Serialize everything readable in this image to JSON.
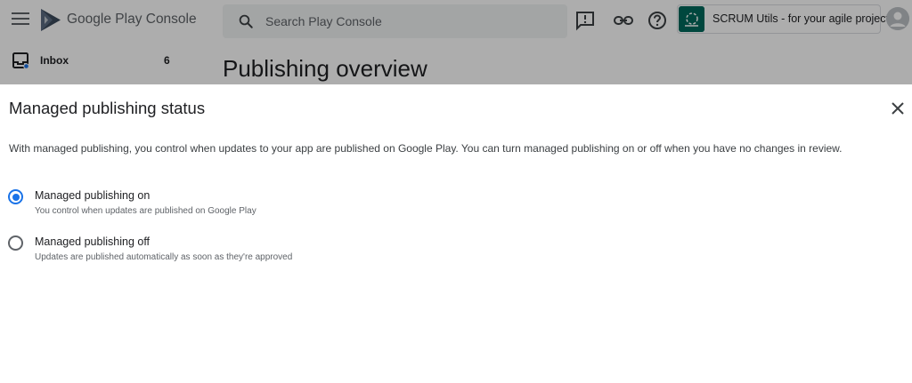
{
  "header": {
    "brand": "Google Play Console",
    "search_placeholder": "Search Play Console",
    "app_name": "SCRUM Utils - for your agile project"
  },
  "sidebar": {
    "items": [
      {
        "label": "Inbox",
        "count": "6"
      }
    ]
  },
  "main": {
    "page_title": "Publishing overview"
  },
  "dialog": {
    "title": "Managed publishing status",
    "description": "With managed publishing, you control when updates to your app are published on Google Play. You can turn managed publishing on or off when you have no changes in review.",
    "options": [
      {
        "label": "Managed publishing on",
        "description": "You control when updates are published on Google Play",
        "selected": true
      },
      {
        "label": "Managed publishing off",
        "description": "Updates are published automatically as soon as they're approved",
        "selected": false
      }
    ]
  },
  "colors": {
    "accent": "#1a73e8",
    "app_thumb": "#00695c",
    "scrim": "rgba(0,0,0,0.32)"
  },
  "icons": {
    "menu": "menu-icon",
    "logo": "google-play-logo-icon",
    "search": "search-icon",
    "feedback": "feedback-icon",
    "link": "link-icon",
    "help": "help-icon",
    "close": "close-icon",
    "inbox": "inbox-icon"
  }
}
